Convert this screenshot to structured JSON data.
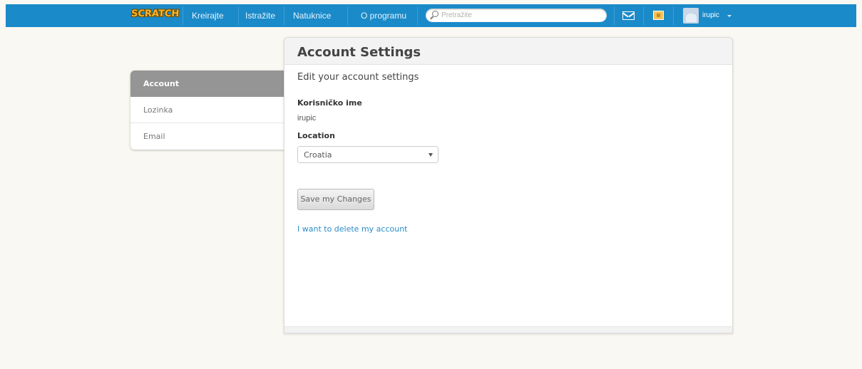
{
  "nav": {
    "logo": "SCRATCH",
    "links": [
      "Kreirajte",
      "Istražite",
      "Natuknice",
      "O programu"
    ],
    "search_placeholder": "Pretražite",
    "username": "irupic"
  },
  "sidebar": {
    "items": [
      {
        "label": "Account",
        "active": true
      },
      {
        "label": "Lozinka",
        "active": false
      },
      {
        "label": "Email",
        "active": false
      }
    ]
  },
  "panel": {
    "title": "Account Settings",
    "subtitle": "Edit your account settings",
    "username_label": "Korisničko ime",
    "username_value": "irupic",
    "location_label": "Location",
    "location_value": "Croatia",
    "save_label": "Save my Changes",
    "delete_link": "I want to delete my account"
  },
  "colors": {
    "nav_bg": "#1b8ac9",
    "page_bg": "#faf8f2",
    "active_tab": "#959595",
    "link": "#2a8cc8"
  }
}
